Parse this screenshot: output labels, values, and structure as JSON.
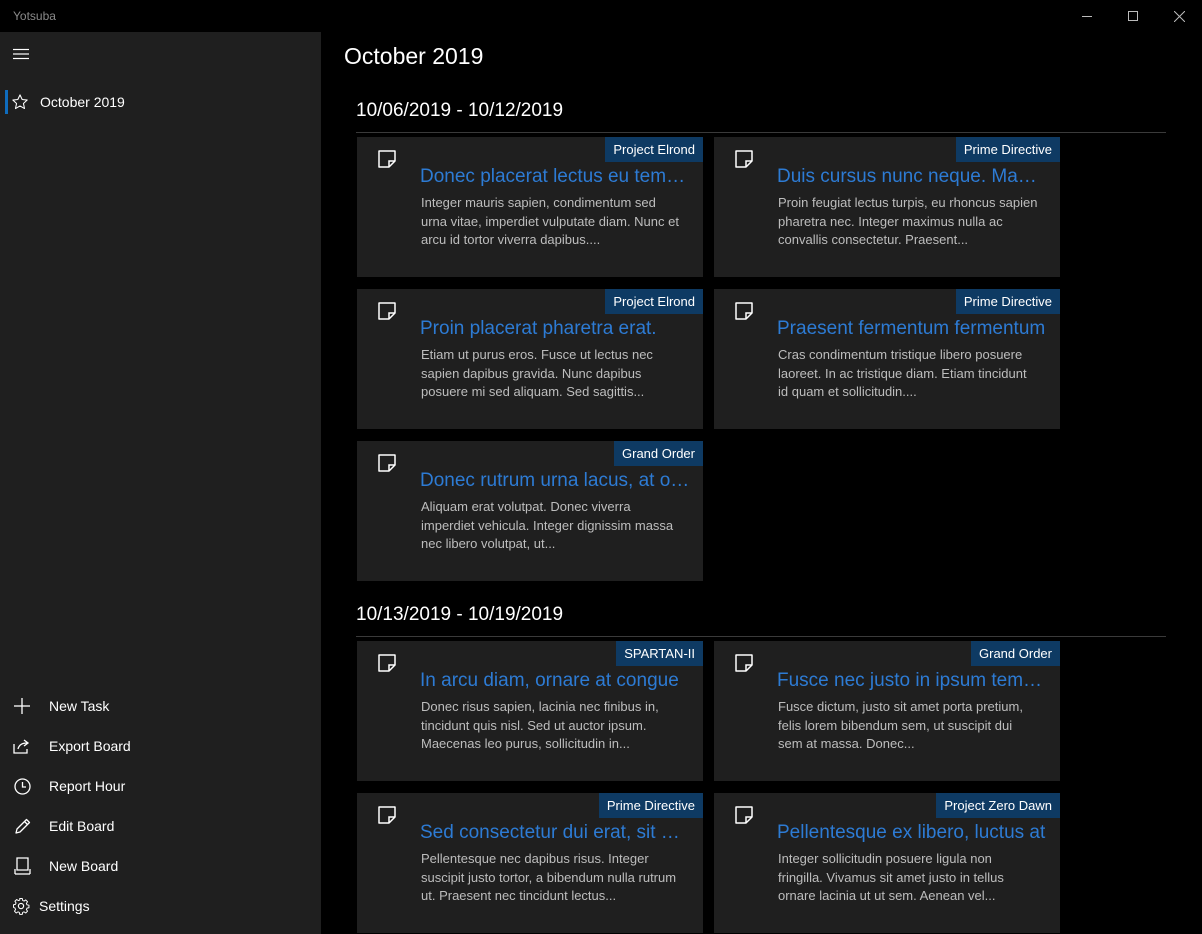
{
  "window": {
    "title": "Yotsuba"
  },
  "sidebar": {
    "boards": [
      {
        "label": "October 2019",
        "icon": "star-icon",
        "selected": true
      }
    ],
    "actions": [
      {
        "label": "New Task",
        "icon": "plus-icon"
      },
      {
        "label": "Export Board",
        "icon": "share-icon"
      },
      {
        "label": "Report Hour",
        "icon": "clock-icon"
      },
      {
        "label": "Edit Board",
        "icon": "pencil-icon"
      },
      {
        "label": "New Board",
        "icon": "new-board-icon"
      },
      {
        "label": "Settings",
        "icon": "gear-icon"
      }
    ]
  },
  "main": {
    "title": "October 2019",
    "weeks": [
      {
        "header": "10/06/2019 - 10/12/2019",
        "cards": [
          {
            "tag": "Project Elrond",
            "title": "Donec placerat lectus eu tempor",
            "body": "Integer mauris sapien, condimentum sed urna vitae, imperdiet vulputate diam. Nunc et arcu id tortor viverra dapibus...."
          },
          {
            "tag": "Prime Directive",
            "title": "Duis cursus nunc neque. Mauris",
            "body": "Proin feugiat lectus turpis, eu rhoncus sapien pharetra nec. Integer maximus nulla ac convallis consectetur. Praesent..."
          },
          {
            "tag": "Project Elrond",
            "title": "Proin placerat pharetra erat.",
            "body": "Etiam ut purus eros. Fusce ut lectus nec sapien dapibus gravida. Nunc dapibus posuere mi sed aliquam. Sed sagittis..."
          },
          {
            "tag": "Prime Directive",
            "title": "Praesent fermentum fermentum",
            "body": "Cras condimentum tristique libero posuere laoreet. In ac tristique diam. Etiam tincidunt id quam et sollicitudin...."
          },
          {
            "tag": "Grand Order",
            "title": "Donec rutrum urna lacus, at ornare",
            "body": "Aliquam erat volutpat. Donec viverra imperdiet vehicula. Integer dignissim massa nec libero volutpat, ut..."
          }
        ]
      },
      {
        "header": "10/13/2019 - 10/19/2019",
        "cards": [
          {
            "tag": "SPARTAN-II",
            "title": "In arcu diam, ornare at congue",
            "body": "Donec risus sapien, lacinia nec finibus in, tincidunt quis nisl. Sed ut auctor ipsum. Maecenas leo purus, sollicitudin in..."
          },
          {
            "tag": "Grand Order",
            "title": "Fusce nec justo in ipsum tempus",
            "body": "Fusce dictum, justo sit amet porta pretium, felis lorem bibendum sem, ut suscipit dui sem at massa. Donec..."
          },
          {
            "tag": "Prime Directive",
            "title": "Sed consectetur dui erat, sit amet",
            "body": "Pellentesque nec dapibus risus. Integer suscipit justo tortor, a bibendum nulla rutrum ut. Praesent nec tincidunt lectus..."
          },
          {
            "tag": "Project Zero Dawn",
            "title": "Pellentesque ex libero, luctus at",
            "body": "Integer sollicitudin posuere ligula non fringilla. Vivamus sit amet justo in tellus ornare lacinia ut ut sem. Aenean vel..."
          }
        ]
      }
    ]
  },
  "colors": {
    "accent": "#0f6cbd",
    "tag_bg": "#0e3a63",
    "card_title": "#2d7bd4",
    "sidebar_bg": "#1f1f1f",
    "card_bg": "#1f1f1f"
  }
}
